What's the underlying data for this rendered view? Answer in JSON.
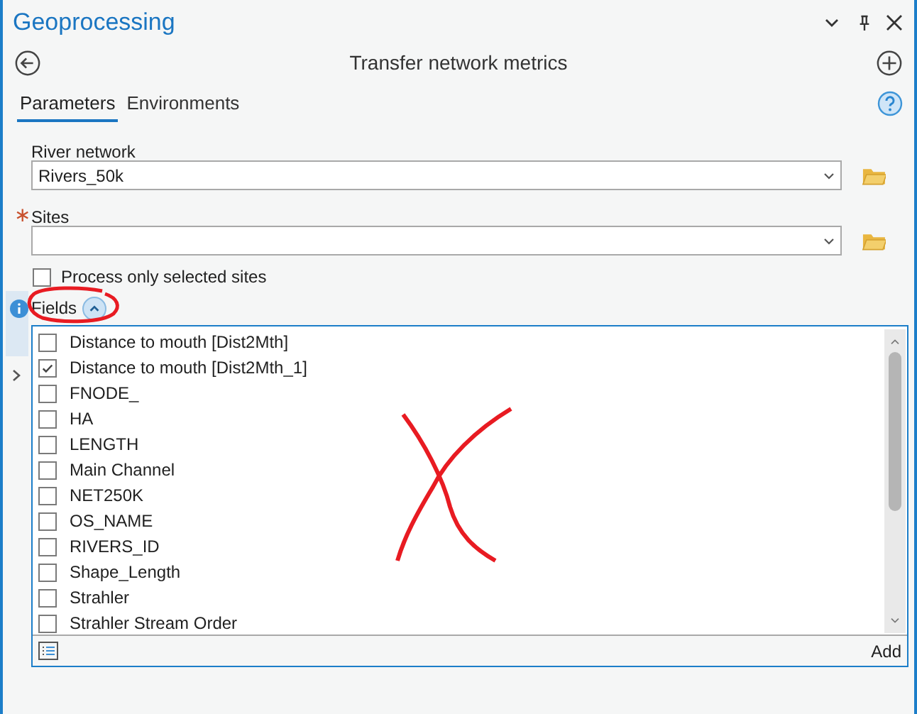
{
  "pane": {
    "title": "Geoprocessing"
  },
  "tool": {
    "title": "Transfer network metrics"
  },
  "tabs": [
    {
      "label": "Parameters",
      "selected": true
    },
    {
      "label": "Environments",
      "selected": false
    }
  ],
  "parameters": [
    {
      "label": "River network",
      "value": "Rivers_50k"
    },
    {
      "label": "Sites",
      "required_marker": "∗"
    }
  ],
  "selected_only": {
    "label": "Process only selected sites",
    "checked": false
  },
  "fields": {
    "label": "Fields",
    "expanded": true,
    "add_label": "Add",
    "items": [
      {
        "label": "Distance to mouth [Dist2Mth]",
        "checked": false
      },
      {
        "label": "Distance to mouth [Dist2Mth_1]",
        "checked": true
      },
      {
        "label": "FNODE_",
        "checked": false
      },
      {
        "label": "HA",
        "checked": false
      },
      {
        "label": "LENGTH",
        "checked": false
      },
      {
        "label": "Main Channel",
        "checked": false
      },
      {
        "label": "NET250K",
        "checked": false
      },
      {
        "label": "OS_NAME",
        "checked": false
      },
      {
        "label": "RIVERS_ID",
        "checked": false
      },
      {
        "label": "Shape_Length",
        "checked": false
      },
      {
        "label": "Strahler",
        "checked": false
      },
      {
        "label": "Strahler Stream Order",
        "checked": false
      }
    ]
  }
}
